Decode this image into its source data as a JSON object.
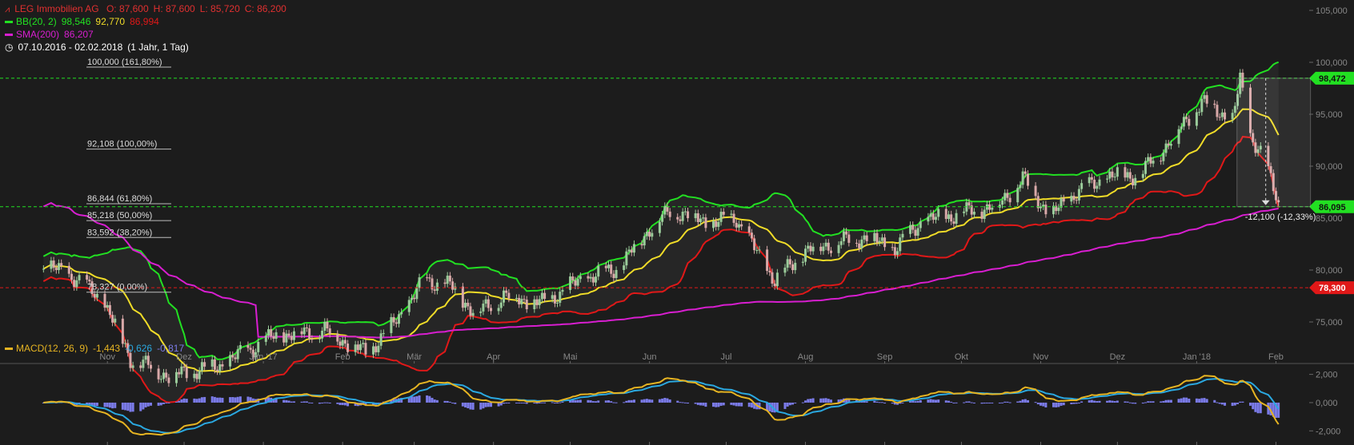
{
  "header": {
    "name": "LEG Immobilien AG",
    "ohlc": {
      "o": "O: 87,600",
      "h": "H: 87,600",
      "l": "L: 85,720",
      "c": "C: 86,200"
    },
    "bb_label": "BB(20, 2)",
    "bb_values": [
      "98,546",
      "92,770",
      "86,994"
    ],
    "sma_label": "SMA(200)",
    "sma_value": "86,207",
    "date_range": "07.10.2016 - 02.02.2018",
    "interval": "(1 Jahr, 1 Tag)"
  },
  "macd_legend": {
    "label": "MACD(12, 26, 9)",
    "values": [
      "-1,443",
      "-0,626",
      "-0,817"
    ]
  },
  "colors": {
    "background": "#1c1c1c",
    "bb_upper": "#22e022",
    "bb_middle": "#f0dc28",
    "bb_lower": "#e01818",
    "sma": "#d81ed0",
    "macd": "#e6b422",
    "signal": "#2aa8e0",
    "histogram": "#7b7be8",
    "candle_up": "#9acb9a",
    "candle_down": "#d8a8a8"
  },
  "chart_data": {
    "type": "candlestick",
    "y_axis": {
      "range": [
        71,
        106
      ],
      "ticks": [
        "75,000",
        "80,000",
        "85,000",
        "90,000",
        "95,000",
        "100,000",
        "105,000"
      ]
    },
    "macd_axis": {
      "range": [
        -3,
        2.6
      ],
      "ticks": [
        "2,000",
        "0,000",
        "-2,000"
      ]
    },
    "months": [
      "Nov",
      "Dez",
      "Jan '17",
      "Feb",
      "Mär",
      "Apr",
      "Mai",
      "Jun",
      "Jul",
      "Aug",
      "Sep",
      "Okt",
      "Nov",
      "Dez",
      "Jan '18",
      "Feb"
    ],
    "close_anchors": [
      {
        "d": "2016-10-07",
        "v": 80.5
      },
      {
        "d": "2016-10-20",
        "v": 79.2
      },
      {
        "d": "2016-10-31",
        "v": 76.8
      },
      {
        "d": "2016-11-10",
        "v": 71.5
      },
      {
        "d": "2016-11-25",
        "v": 69.8
      },
      {
        "d": "2016-12-15",
        "v": 70.8
      },
      {
        "d": "2017-01-05",
        "v": 73.6
      },
      {
        "d": "2017-01-25",
        "v": 74.2
      },
      {
        "d": "2017-02-10",
        "v": 72.0
      },
      {
        "d": "2017-02-20",
        "v": 74.5
      },
      {
        "d": "2017-03-05",
        "v": 79.0
      },
      {
        "d": "2017-03-15",
        "v": 78.5
      },
      {
        "d": "2017-03-25",
        "v": 75.8
      },
      {
        "d": "2017-04-05",
        "v": 77.5
      },
      {
        "d": "2017-04-20",
        "v": 76.8
      },
      {
        "d": "2017-05-05",
        "v": 79.0
      },
      {
        "d": "2017-05-20",
        "v": 80.2
      },
      {
        "d": "2017-06-01",
        "v": 84.0
      },
      {
        "d": "2017-06-10",
        "v": 85.8
      },
      {
        "d": "2017-06-25",
        "v": 84.5
      },
      {
        "d": "2017-07-05",
        "v": 85.0
      },
      {
        "d": "2017-07-12",
        "v": 82.0
      },
      {
        "d": "2017-07-20",
        "v": 79.0
      },
      {
        "d": "2017-08-01",
        "v": 81.8
      },
      {
        "d": "2017-08-10",
        "v": 82.5
      },
      {
        "d": "2017-08-25",
        "v": 83.2
      },
      {
        "d": "2017-09-05",
        "v": 82.0
      },
      {
        "d": "2017-09-15",
        "v": 84.6
      },
      {
        "d": "2017-10-01",
        "v": 85.5
      },
      {
        "d": "2017-10-15",
        "v": 86.2
      },
      {
        "d": "2017-10-25",
        "v": 88.8
      },
      {
        "d": "2017-11-05",
        "v": 85.2
      },
      {
        "d": "2017-11-15",
        "v": 87.5
      },
      {
        "d": "2017-11-28",
        "v": 89.0
      },
      {
        "d": "2017-12-10",
        "v": 89.2
      },
      {
        "d": "2017-12-20",
        "v": 92.0
      },
      {
        "d": "2018-01-03",
        "v": 96.2
      },
      {
        "d": "2018-01-10",
        "v": 95.2
      },
      {
        "d": "2018-01-15",
        "v": 94.5
      },
      {
        "d": "2018-01-18",
        "v": 98.2
      },
      {
        "d": "2018-01-22",
        "v": 93.0
      },
      {
        "d": "2018-01-26",
        "v": 91.5
      },
      {
        "d": "2018-01-30",
        "v": 88.5
      },
      {
        "d": "2018-02-02",
        "v": 86.2
      }
    ],
    "hlines": [
      {
        "value": 98.472,
        "label": "98,472",
        "color": "#22e022"
      },
      {
        "value": 86.095,
        "label": "86,095",
        "color": "#22e022"
      },
      {
        "value": 78.3,
        "label": "78,300",
        "color": "#e01818"
      }
    ],
    "fibonacci": [
      {
        "value": 100.0,
        "label": "100,000 (161,80%)"
      },
      {
        "value": 92.108,
        "label": "92,108 (100,00%)"
      },
      {
        "value": 86.844,
        "label": "86,844 (61,80%)"
      },
      {
        "value": 85.218,
        "label": "85,218 (50,00%)"
      },
      {
        "value": 83.592,
        "label": "83,592 (38,20%)"
      },
      {
        "value": 78.327,
        "label": "78,327 (0,00%)"
      }
    ],
    "measurement": {
      "from_date": "2018-01-18",
      "to_date": "2018-02-02",
      "from": 98.472,
      "to": 86.095,
      "label": "-12,100 (-12,33%)"
    }
  }
}
